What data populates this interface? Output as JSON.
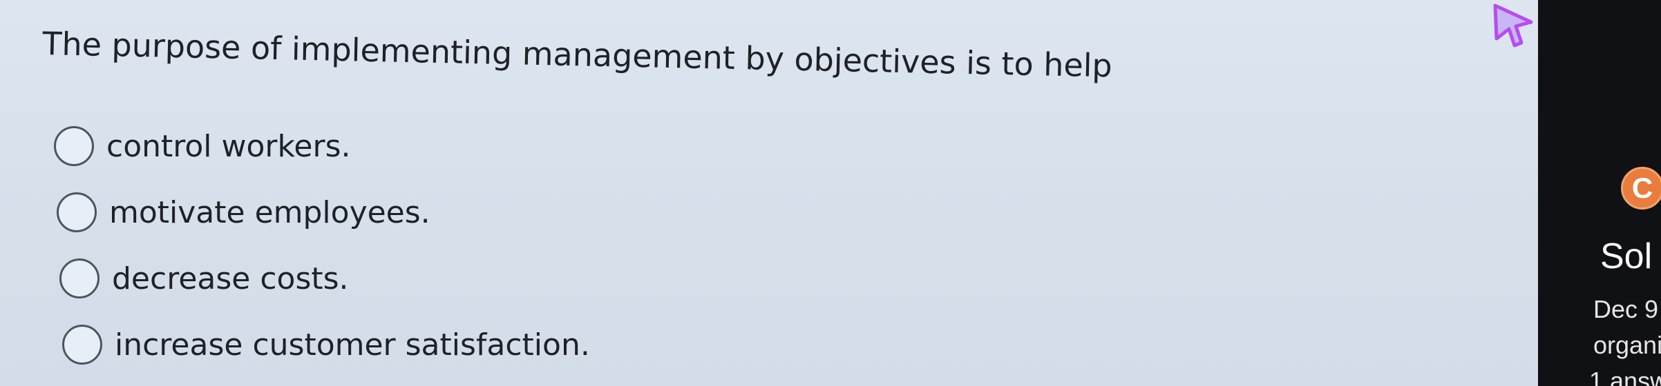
{
  "question": {
    "text": "The purpose of implementing management by objectives is to help"
  },
  "options": [
    {
      "label": "control workers."
    },
    {
      "label": "motivate employees."
    },
    {
      "label": "decrease costs."
    },
    {
      "label": "increase customer satisfaction."
    }
  ],
  "sidebar": {
    "logo_letter": "C",
    "title": "Sol",
    "date": "Dec 9",
    "tag": "organi",
    "answers": "1 answ"
  },
  "colors": {
    "background": "#d6e0eb",
    "sidebar": "#101114",
    "logo": "#e87d3e",
    "cursor": "#b84cf0"
  },
  "icons": {
    "cursor": "mouse-pointer-icon",
    "radio": "radio-button-icon"
  }
}
